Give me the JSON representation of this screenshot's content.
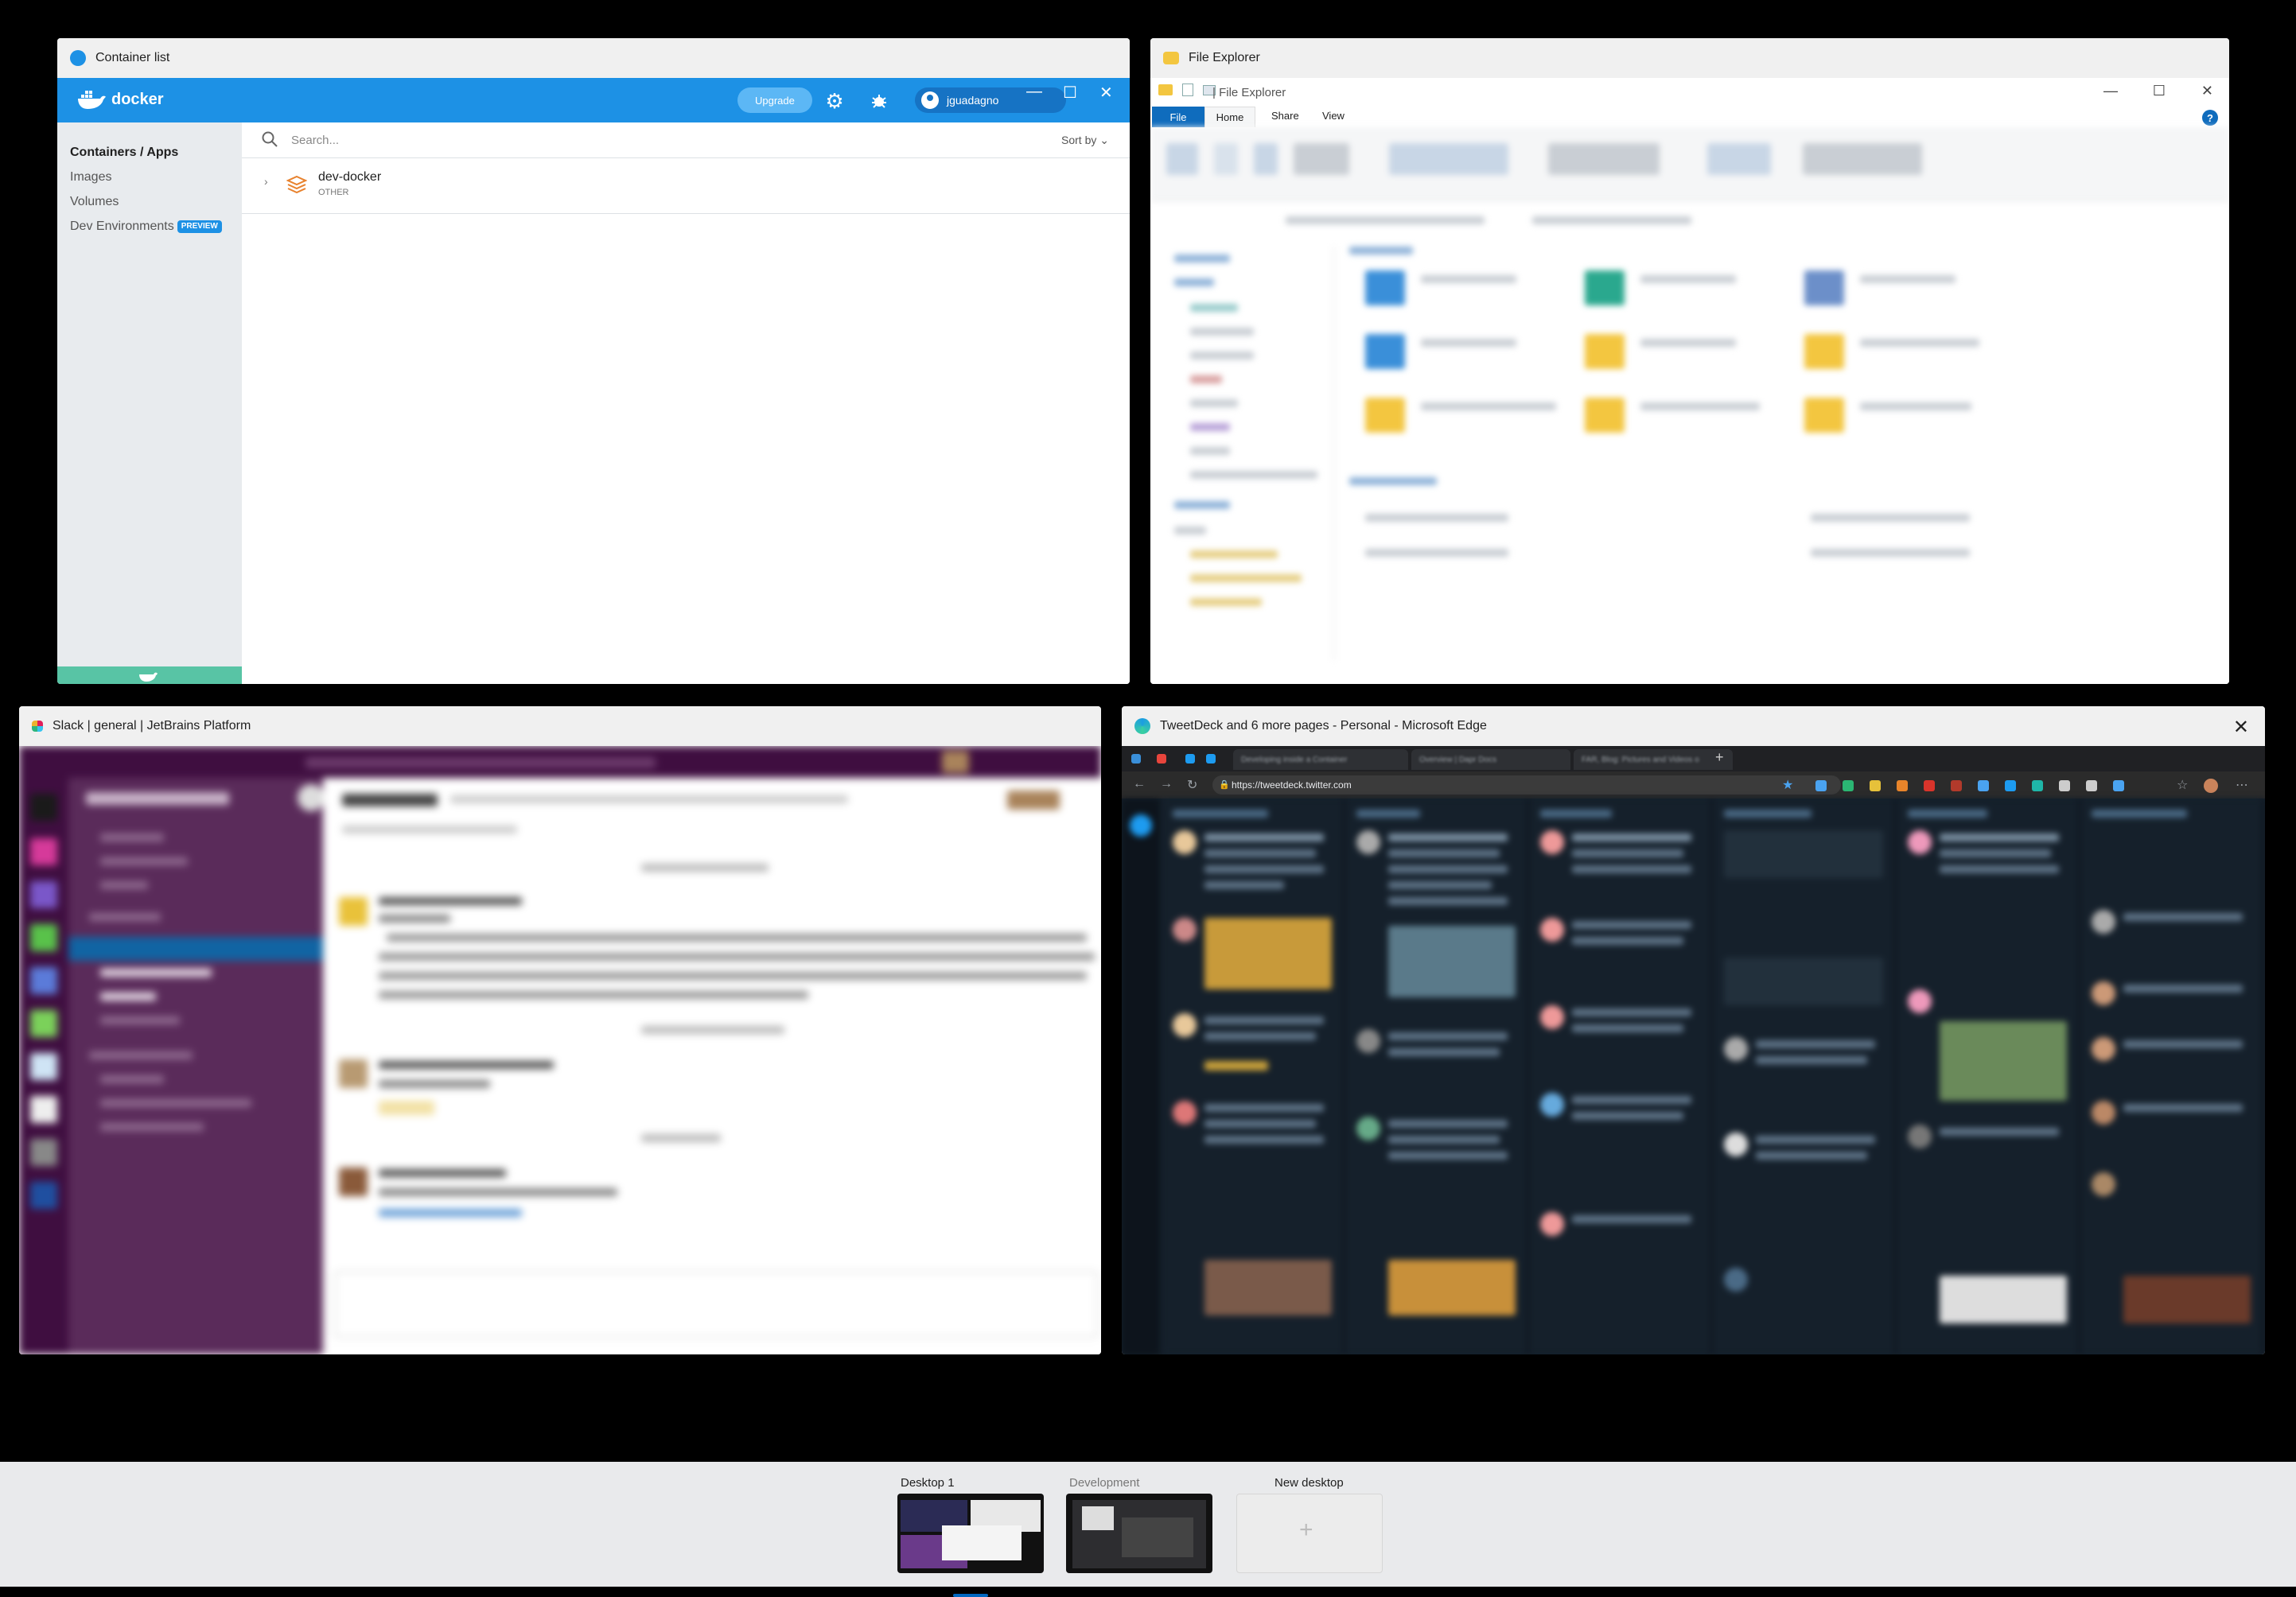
{
  "docker_window": {
    "title": "Container list",
    "brand": "docker",
    "upgrade_label": "Upgrade",
    "username": "jguadagno",
    "sidebar": {
      "items": [
        {
          "label": "Containers / Apps",
          "active": true
        },
        {
          "label": "Images"
        },
        {
          "label": "Volumes"
        },
        {
          "label": "Dev Environments",
          "badge": "PREVIEW"
        }
      ]
    },
    "search_placeholder": "Search...",
    "sort_label": "Sort by",
    "containers": [
      {
        "name": "dev-docker",
        "type": "OTHER"
      }
    ],
    "colors": {
      "header": "#1d91e5",
      "footer": "#58c4a5"
    }
  },
  "explorer_window": {
    "title": "File Explorer",
    "inner_title": "File Explorer",
    "tabs": [
      "File",
      "Home",
      "Share",
      "View"
    ]
  },
  "slack_window": {
    "title": "Slack | general | JetBrains Platform"
  },
  "edge_window": {
    "title": "TweetDeck and 6 more pages - Personal - Microsoft Edge",
    "url": "https://tweetdeck.twitter.com",
    "tabs": [
      {
        "label": "Developing inside a Container"
      },
      {
        "label": "Overview | Dapr Docs"
      },
      {
        "label": "FAR, Blog: Pictures and Videos o"
      }
    ]
  },
  "task_view": {
    "desktops": [
      {
        "label": "Desktop 1",
        "active": true
      },
      {
        "label": "Development"
      },
      {
        "label": "New desktop"
      }
    ]
  }
}
